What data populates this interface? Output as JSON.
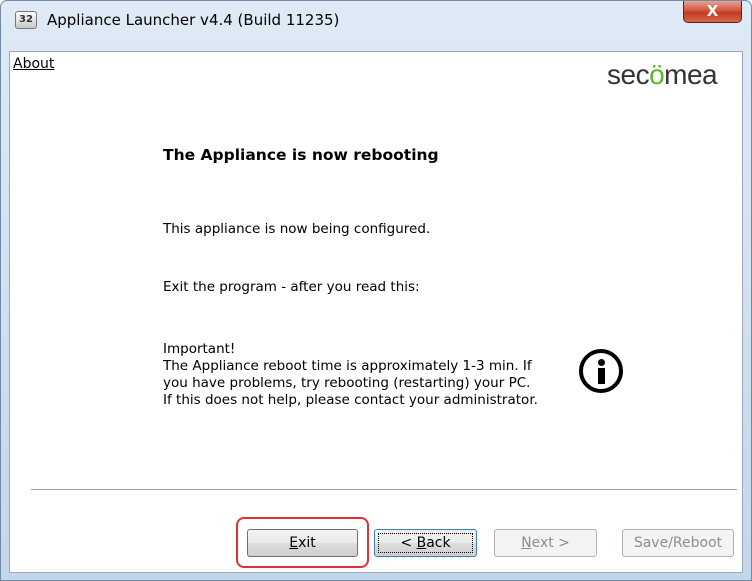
{
  "window": {
    "title": "Appliance Launcher v4.4 (Build 11235)",
    "app_icon_text": "32",
    "close_glyph": "X"
  },
  "menu": {
    "about_label": "About"
  },
  "brand": {
    "logo_part1": "sec",
    "logo_accent": "ö",
    "logo_part2": "mea",
    "accent_color": "#59b72c"
  },
  "content": {
    "heading": "The Appliance is now rebooting",
    "line1": "This appliance is now being configured.",
    "line2": "Exit the program - after you read this:",
    "important": [
      "Important!",
      "The Appliance reboot time is approximately 1-3 min. If",
      "you have problems, try rebooting (restarting) your PC.",
      "If this does not help, please contact your administrator."
    ],
    "info_icon": "info-icon"
  },
  "buttons": {
    "exit": {
      "mnemonic": "E",
      "rest": "xit"
    },
    "back": {
      "prefix": "< ",
      "mnemonic": "B",
      "rest": "ack"
    },
    "next": {
      "mnemonic": "N",
      "rest": "ext >"
    },
    "save_reboot": "Save/Reboot"
  },
  "annotation": {
    "highlight_color": "#e03232"
  }
}
